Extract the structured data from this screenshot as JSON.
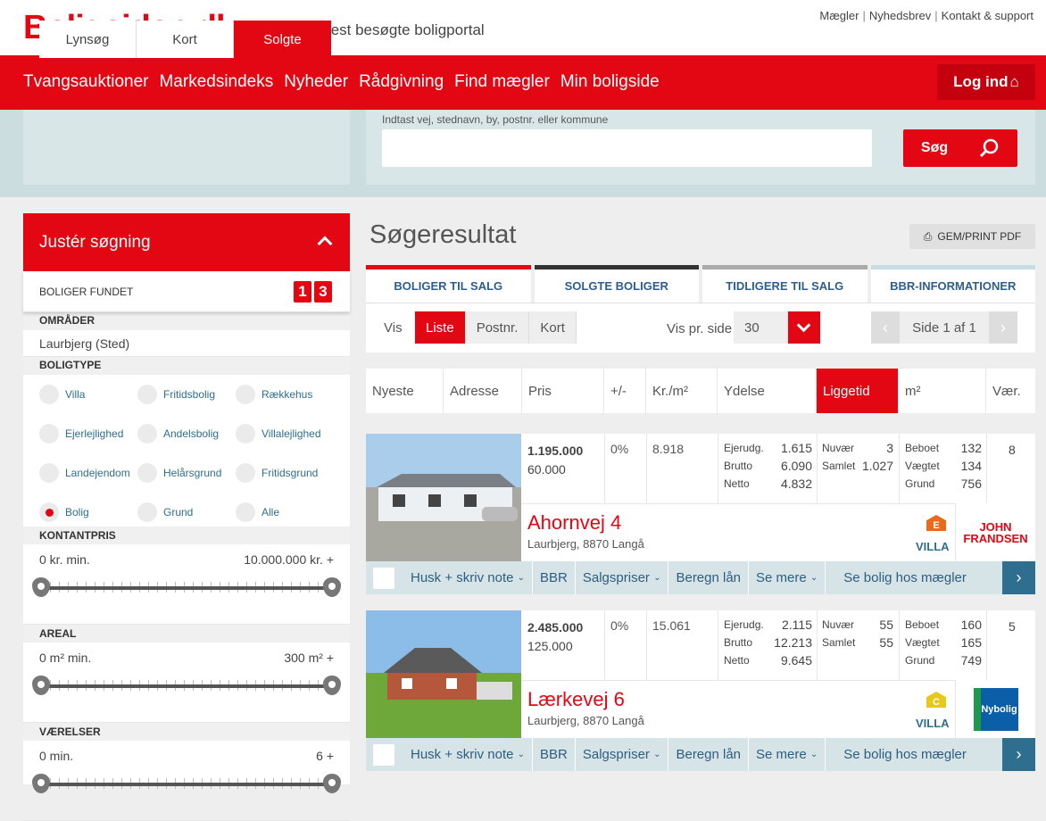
{
  "brand": {
    "logo": "Boligsiden.dk",
    "dash": "-",
    "tagline": "Danmarks mest besøgte boligportal",
    "accent": "#e30613"
  },
  "toplinks": [
    "Mægler",
    "Nyhedsbrev",
    "Kontakt & support"
  ],
  "nav": {
    "items": [
      "Tvangsauktioner",
      "Markedsindeks",
      "Nyheder",
      "Rådgivning",
      "Find mægler",
      "Min boligside"
    ],
    "login": "Log ind"
  },
  "search": {
    "modes": [
      "Lynsøg",
      "Kort",
      "Solgte"
    ],
    "active_mode": "Solgte",
    "label": "Indtast vej, stednavn, by, postnr. eller kommune",
    "value": "",
    "button": "Søg"
  },
  "sidebar": {
    "title": "Justér søgning",
    "found_label": "BOLIGER FUNDET",
    "found_digits": [
      "1",
      "3"
    ],
    "areas_head": "OMRÅDER",
    "area": "Laurbjerg (Sted)",
    "types_head": "BOLIGTYPE",
    "types": [
      "Villa",
      "Fritidsbolig",
      "Rækkehus",
      "Ejerlejlighed",
      "Andelsbolig",
      "Villalejlighed",
      "Landejendom",
      "Helårsgrund",
      "Fritidsgrund",
      "Bolig",
      "Grund",
      "Alle"
    ],
    "selected_type": "Bolig",
    "price_head": "KONTANTPRIS",
    "price_min": "0 kr. min.",
    "price_max": "10.000.000 kr. +",
    "area_head": "AREAL",
    "area_min": "0 m² min.",
    "area_max": "300 m² +",
    "rooms_head": "VÆRELSER",
    "rooms_min": "0 min.",
    "rooms_max": "6 +"
  },
  "main": {
    "title": "Søgeresultat",
    "print": "GEM/PRINT PDF",
    "tabs": [
      "BOLIGER TIL SALG",
      "SOLGTE BOLIGER",
      "TIDLIGERE TIL SALG",
      "BBR-INFORMATIONER"
    ],
    "vis": "Vis",
    "view_modes": [
      "Liste",
      "Postnr.",
      "Kort"
    ],
    "per_page_label": "Vis pr. side",
    "per_page": "30",
    "pager": "Side 1 af 1",
    "sort": [
      "Nyeste",
      "Adresse",
      "Pris",
      "+/-",
      "Kr./m²",
      "Ydelse",
      "Liggetid",
      "m²",
      "Vær."
    ],
    "active_sort": "Liggetid"
  },
  "listings": [
    {
      "price": "1.195.000",
      "down": "60.000",
      "pct": "0%",
      "krm": "8.918",
      "ejerudg_l": "Ejerudg.",
      "ejerudg": "1.615",
      "brutto_l": "Brutto",
      "brutto": "6.090",
      "netto_l": "Netto",
      "netto": "4.832",
      "nuvaer_l": "Nuvær",
      "nuvaer": "3",
      "samlet_l": "Samlet",
      "samlet": "1.027",
      "beboet_l": "Beboet",
      "beboet": "132",
      "vaegtet_l": "Vægtet",
      "vaegtet": "134",
      "grund_l": "Grund",
      "grund": "756",
      "rooms": "8",
      "address": "Ahornvej 4",
      "city": "Laurbjerg, 8870 Langå",
      "type": "VILLA",
      "energy": "E",
      "energy_color": "#e86a1c",
      "agent": "JOHN FRANDSEN"
    },
    {
      "price": "2.485.000",
      "down": "125.000",
      "pct": "0%",
      "krm": "15.061",
      "ejerudg_l": "Ejerudg.",
      "ejerudg": "2.115",
      "brutto_l": "Brutto",
      "brutto": "12.213",
      "netto_l": "Netto",
      "netto": "9.645",
      "nuvaer_l": "Nuvær",
      "nuvaer": "55",
      "samlet_l": "Samlet",
      "samlet": "55",
      "beboet_l": "Beboet",
      "beboet": "160",
      "vaegtet_l": "Vægtet",
      "vaegtet": "165",
      "grund_l": "Grund",
      "grund": "749",
      "rooms": "5",
      "address": "Lærkevej 6",
      "city": "Laurbjerg, 8870 Langå",
      "type": "VILLA",
      "energy": "C",
      "energy_color": "#e8c81c",
      "agent": "Nybolig"
    }
  ],
  "actions": [
    "Husk + skriv note",
    "BBR",
    "Salgspriser",
    "Beregn lån",
    "Se mere",
    "Se bolig hos mægler"
  ]
}
